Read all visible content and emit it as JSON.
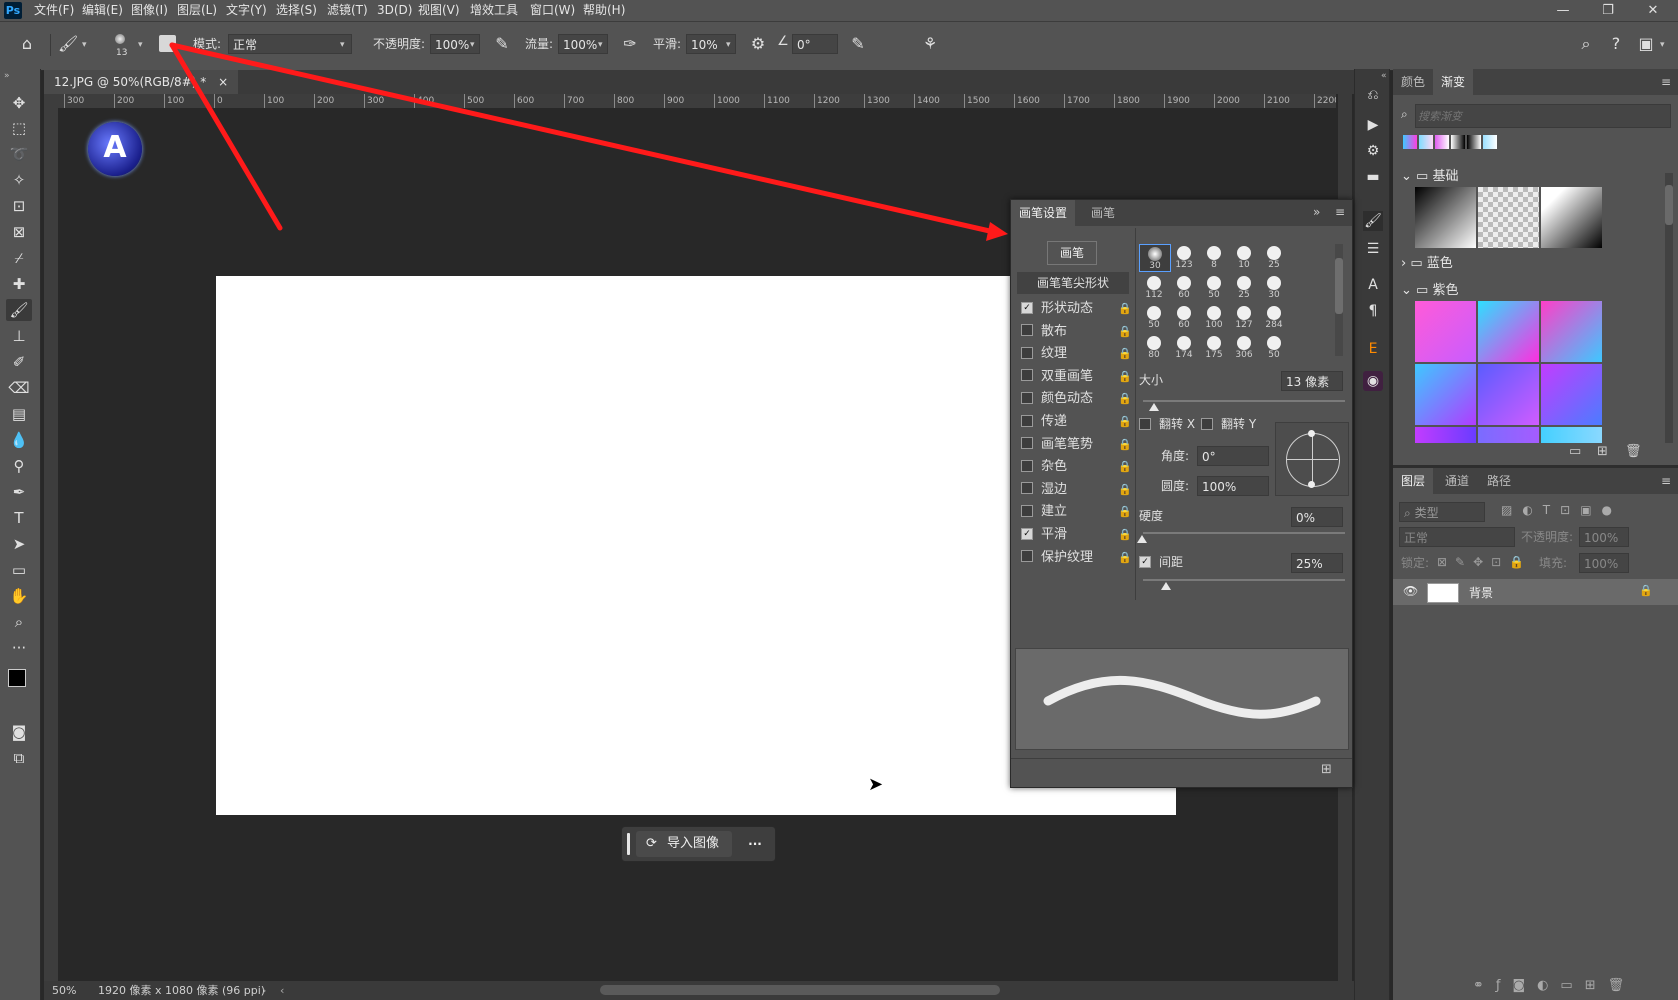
{
  "app": {
    "logo": "Ps"
  },
  "menu": [
    "文件(F)",
    "编辑(E)",
    "图像(I)",
    "图层(L)",
    "文字(Y)",
    "选择(S)",
    "滤镜(T)",
    "3D(D)",
    "视图(V)",
    "增效工具",
    "窗口(W)",
    "帮助(H)"
  ],
  "window_buttons": [
    "—",
    "❐",
    "✕"
  ],
  "options": {
    "brush_size": "13",
    "mode_label": "模式:",
    "mode_value": "正常",
    "opacity_label": "不透明度:",
    "opacity_value": "100%",
    "flow_label": "流量:",
    "flow_value": "100%",
    "smooth_label": "平滑:",
    "smooth_value": "10%",
    "angle_value": "0°"
  },
  "doc_tab": {
    "title": "12.JPG @ 50%(RGB/8#) *",
    "close": "×"
  },
  "ruler_ticks": [
    "300",
    "200",
    "100",
    "0",
    "100",
    "200",
    "300",
    "400",
    "500",
    "600",
    "700",
    "800",
    "900",
    "1000",
    "1100",
    "1200",
    "1300",
    "1400",
    "1500",
    "1600",
    "1700",
    "1800",
    "1900",
    "2000",
    "2100",
    "2200"
  ],
  "status": {
    "zoom": "50%",
    "info": "1920 像素 x 1080 像素 (96 ppi)"
  },
  "float_bar": {
    "import_label": "导入图像",
    "more": "···"
  },
  "gradients_panel": {
    "tabs": [
      "颜色",
      "渐变"
    ],
    "search_placeholder": "搜索渐变",
    "groups": [
      "基础",
      "蓝色",
      "紫色"
    ],
    "swatch_colors": [
      "#3ec8ff",
      "#e05cf0",
      "#7fdcff",
      "#ffffff",
      "#000000",
      "#9be0ff"
    ]
  },
  "brush_panel": {
    "tabs": [
      "画笔设置",
      "画笔"
    ],
    "brush_button": "画笔",
    "tip_shape_label": "画笔笔尖形状",
    "options": [
      {
        "label": "形状动态",
        "checked": true
      },
      {
        "label": "散布",
        "checked": false
      },
      {
        "label": "纹理",
        "checked": false
      },
      {
        "label": "双重画笔",
        "checked": false
      },
      {
        "label": "颜色动态",
        "checked": false
      },
      {
        "label": "传递",
        "checked": false
      },
      {
        "label": "画笔笔势",
        "checked": false
      },
      {
        "label": "杂色",
        "checked": false
      },
      {
        "label": "湿边",
        "checked": false
      },
      {
        "label": "建立",
        "checked": false
      },
      {
        "label": "平滑",
        "checked": true
      },
      {
        "label": "保护纹理",
        "checked": false
      }
    ],
    "tip_sizes": [
      "30",
      "123",
      "8",
      "10",
      "25",
      "112",
      "60",
      "50",
      "25",
      "30",
      "50",
      "60",
      "100",
      "127",
      "284",
      "80",
      "174",
      "175",
      "306",
      "50"
    ],
    "size_label": "大小",
    "size_value": "13 像素",
    "flip_x": "翻转 X",
    "flip_y": "翻转 Y",
    "angle_label": "角度:",
    "angle_value": "0°",
    "roundness_label": "圆度:",
    "roundness_value": "100%",
    "hardness_label": "硬度",
    "hardness_value": "0%",
    "spacing_label": "间距",
    "spacing_value": "25%"
  },
  "layers_panel": {
    "tabs": [
      "图层",
      "通道",
      "路径"
    ],
    "kind_placeholder": "类型",
    "blend": "正常",
    "opacity_label": "不透明度:",
    "opacity_value": "100%",
    "lock_label": "锁定:",
    "fill_label": "填充:",
    "fill_value": "100%",
    "layer_name": "背景"
  },
  "annotation": {
    "color": "#ff1a1a"
  }
}
